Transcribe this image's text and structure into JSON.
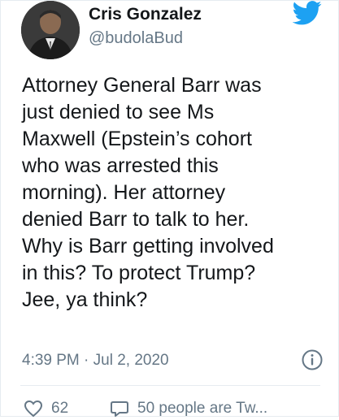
{
  "user": {
    "display_name": "Cris Gonzalez",
    "handle": "@budolaBud"
  },
  "tweet": {
    "text": "Attorney General Barr was\njust denied to see Ms\nMaxwell (Epstein’s cohort\nwho was arrested this\nmorning). Her attorney\ndenied Barr to talk to her.\nWhy is Barr getting involved\nin this? To protect Trump?\nJee, ya think?",
    "timestamp": "4:39 PM · Jul 2, 2020"
  },
  "actions": {
    "like_count": "62",
    "reply_text": "50 people are Tw..."
  },
  "icons": {
    "brand": "twitter-bird-icon",
    "info": "info-icon",
    "like": "heart-icon",
    "reply": "speech-bubble-icon"
  },
  "colors": {
    "brand_blue": "#1da1f2",
    "text": "#14171a",
    "muted": "#657786",
    "border": "#e6ecf0"
  }
}
